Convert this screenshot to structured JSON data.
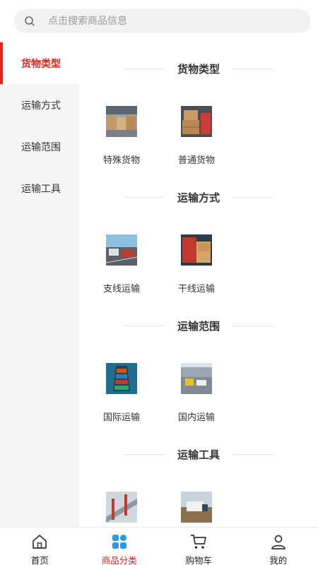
{
  "search": {
    "placeholder": "点击搜索商品信息"
  },
  "sidebar": {
    "items": [
      {
        "label": "货物类型",
        "active": true
      },
      {
        "label": "运输方式",
        "active": false
      },
      {
        "label": "运输范围",
        "active": false
      },
      {
        "label": "运输工具",
        "active": false
      }
    ]
  },
  "sections": [
    {
      "title": "货物类型",
      "items": [
        {
          "label": "特殊货物"
        },
        {
          "label": "普通货物"
        }
      ]
    },
    {
      "title": "运输方式",
      "items": [
        {
          "label": "支线运输"
        },
        {
          "label": "干线运输"
        }
      ]
    },
    {
      "title": "运输范围",
      "items": [
        {
          "label": "国际运输"
        },
        {
          "label": "国内运输"
        }
      ]
    },
    {
      "title": "运输工具",
      "items": [
        {
          "label": ""
        },
        {
          "label": ""
        }
      ]
    }
  ],
  "tabbar": {
    "items": [
      {
        "label": "首页",
        "icon": "home-icon"
      },
      {
        "label": "商品分类",
        "icon": "category-icon"
      },
      {
        "label": "购物车",
        "icon": "cart-icon"
      },
      {
        "label": "我的",
        "icon": "user-icon"
      }
    ],
    "active_color": "#e2231a"
  },
  "colors": {
    "accent": "#e2231a",
    "sidebar_bg": "#f5f5f5",
    "search_bg": "#f2f2f2"
  }
}
